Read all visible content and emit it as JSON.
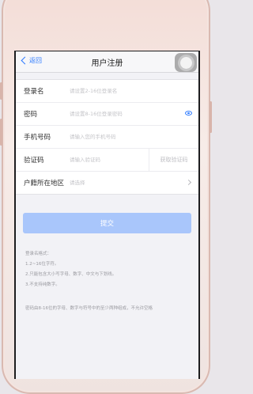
{
  "nav": {
    "back_label": "返回",
    "title": "用户注册"
  },
  "form": {
    "username": {
      "label": "登录名",
      "placeholder": "请设置2-16位登录名"
    },
    "password": {
      "label": "密码",
      "placeholder": "请设置8-16位登录密码"
    },
    "phone": {
      "label": "手机号码",
      "placeholder": "请输入您的手机号码"
    },
    "code": {
      "label": "验证码",
      "placeholder": "请输入验证码",
      "get_code_label": "获取验证码"
    },
    "region": {
      "label": "户籍所在地区",
      "placeholder": "请选择"
    }
  },
  "submit_label": "提交",
  "notes": {
    "username_title": "登录名格式：",
    "username_rules": [
      "1.2~16位字符。",
      "2.只能包含大小写字母、数字、中文与下划线。",
      "3.不支持纯数字。"
    ],
    "password_rule": "密码由8-16位的字母、数字与符号中的至少两种组成，不允许空格"
  },
  "colors": {
    "accent": "#2e7bff",
    "submit_disabled": "#a9c6fb",
    "frame": "#f3dcd6"
  }
}
